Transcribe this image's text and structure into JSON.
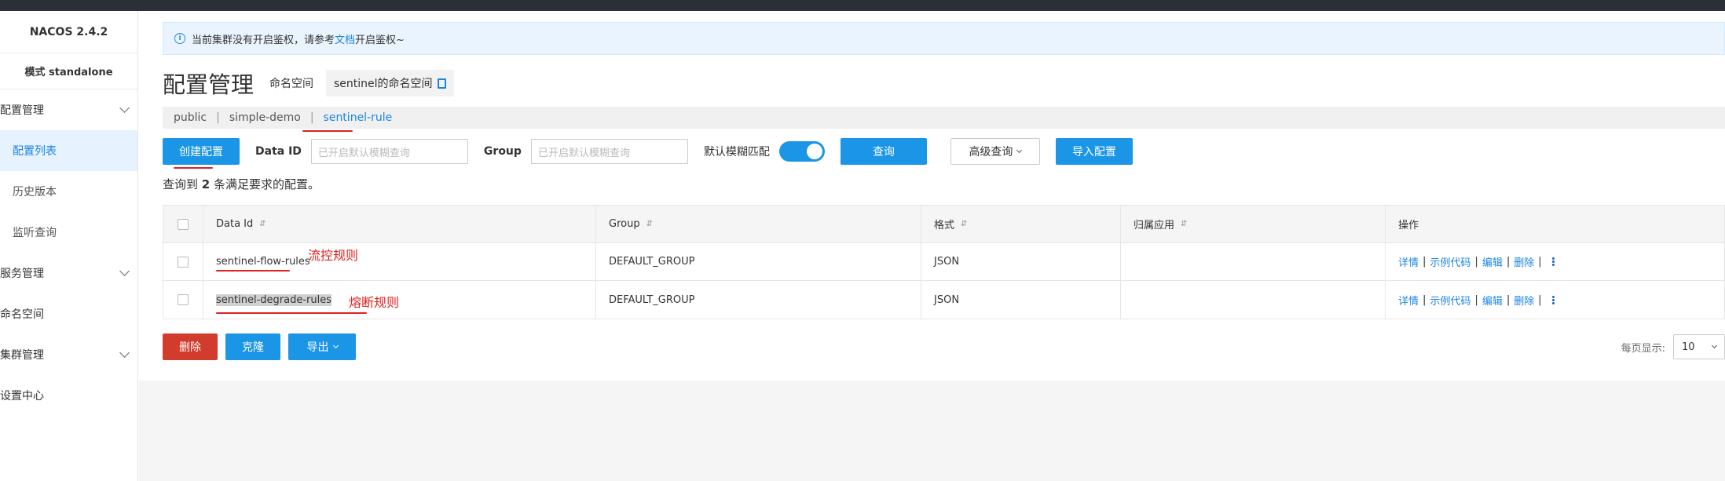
{
  "app": {
    "brand": "NACOS 2.4.2",
    "mode": "模式 standalone"
  },
  "sidebar": {
    "config_group": "配置管理",
    "config_items": [
      "配置列表",
      "历史版本",
      "监听查询"
    ],
    "service_group": "服务管理",
    "namespace": "命名空间",
    "cluster_group": "集群管理",
    "settings": "设置中心"
  },
  "alert": {
    "text_before": "当前集群没有开启鉴权，请参考",
    "link": "文档",
    "text_after": "开启鉴权~",
    "icon": "info-icon"
  },
  "header": {
    "title": "配置管理",
    "namespace_label": "命名空间",
    "namespace_value": "sentinel的命名空间",
    "copy_icon": "copy-icon"
  },
  "namespaces": [
    "public",
    "simple-demo",
    "sentinel-rule"
  ],
  "namespace_separator": "|",
  "toolbar": {
    "create_label": "创建配置",
    "dataid_label": "Data ID",
    "dataid_placeholder": "已开启默认模糊查询",
    "group_label": "Group",
    "group_placeholder": "已开启默认模糊查询",
    "fuzzy_label": "默认模糊匹配",
    "fuzzy_on": true,
    "query_label": "查询",
    "advanced_label": "高级查询",
    "import_label": "导入配置"
  },
  "result": {
    "prefix": "查询到",
    "count": "2",
    "suffix": "条满足要求的配置。"
  },
  "table": {
    "sort_icon": "⇵",
    "headers": [
      "Data Id",
      "Group",
      "格式",
      "归属应用",
      "操作"
    ],
    "rows": [
      {
        "data_id": "sentinel-flow-rules",
        "group": "DEFAULT_GROUP",
        "format": "JSON",
        "app": "",
        "annotation": "流控规则"
      },
      {
        "data_id": "sentinel-degrade-rules",
        "group": "DEFAULT_GROUP",
        "format": "JSON",
        "app": "",
        "annotation": "熔断规则"
      }
    ],
    "ops": [
      "详情",
      "示例代码",
      "编辑",
      "删除"
    ],
    "op_separator": "|"
  },
  "bottom": {
    "delete_label": "删除",
    "clone_label": "克隆",
    "export_label": "导出"
  },
  "pager": {
    "label": "每页显示:",
    "page_size": "10"
  },
  "colors": {
    "primary": "#1b95e6",
    "danger": "#d23c2c",
    "annotation": "#e02020",
    "link": "#1b84e6"
  }
}
